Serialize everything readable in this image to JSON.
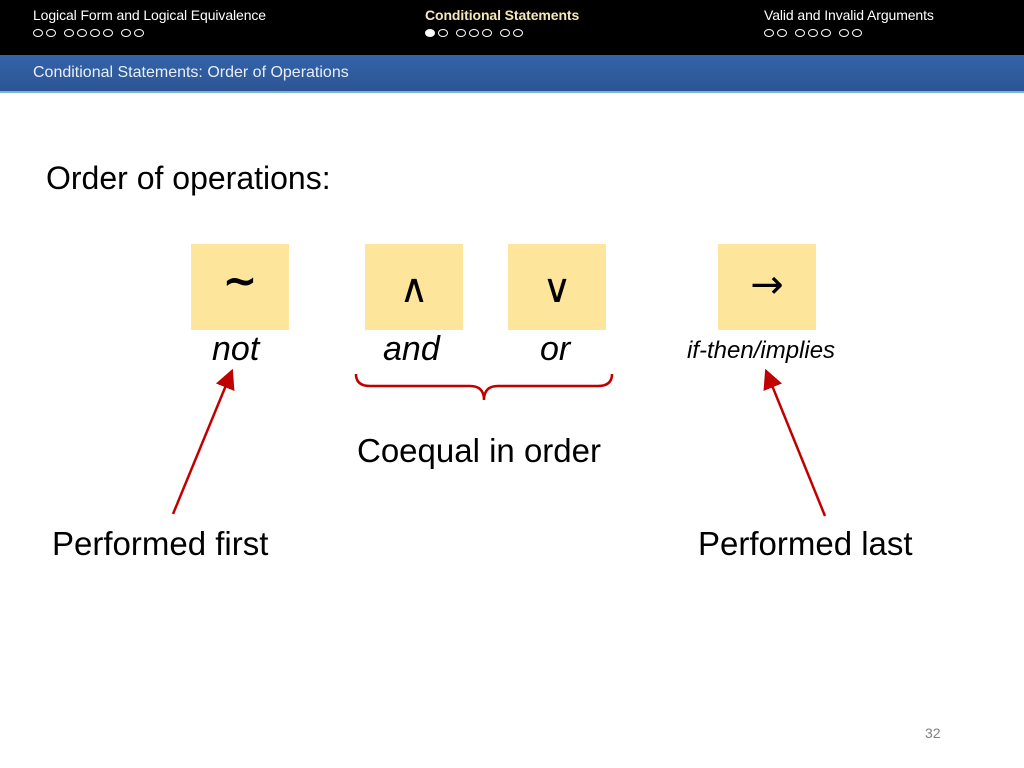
{
  "header": {
    "sections": [
      {
        "title": "Logical Form and Logical Equivalence",
        "active": false,
        "dots": 7,
        "filled_index": -1
      },
      {
        "title": "Conditional Statements",
        "active": true,
        "dots": 7,
        "filled_index": 0
      },
      {
        "title": "Valid and Invalid Arguments",
        "active": false,
        "dots": 7,
        "filled_index": -1
      }
    ]
  },
  "subheader": {
    "title": "Conditional Statements: Order of Operations"
  },
  "content": {
    "heading": "Order of operations:",
    "operators": [
      {
        "symbol": "~",
        "label": "not"
      },
      {
        "symbol": "∧",
        "label": "and"
      },
      {
        "symbol": "∨",
        "label": "or"
      },
      {
        "symbol": "→",
        "label": "if-then/implies"
      }
    ],
    "brace_label": "Coequal in order",
    "left_note": "Performed first",
    "right_note": "Performed last"
  },
  "colors": {
    "operator_box": "#fde59b",
    "arrow": "#c00000",
    "header_bg": "#000000",
    "subheader_bg": "#2f5a9e",
    "active_section": "#f5e8b8"
  },
  "footer": {
    "page_number": "32"
  }
}
